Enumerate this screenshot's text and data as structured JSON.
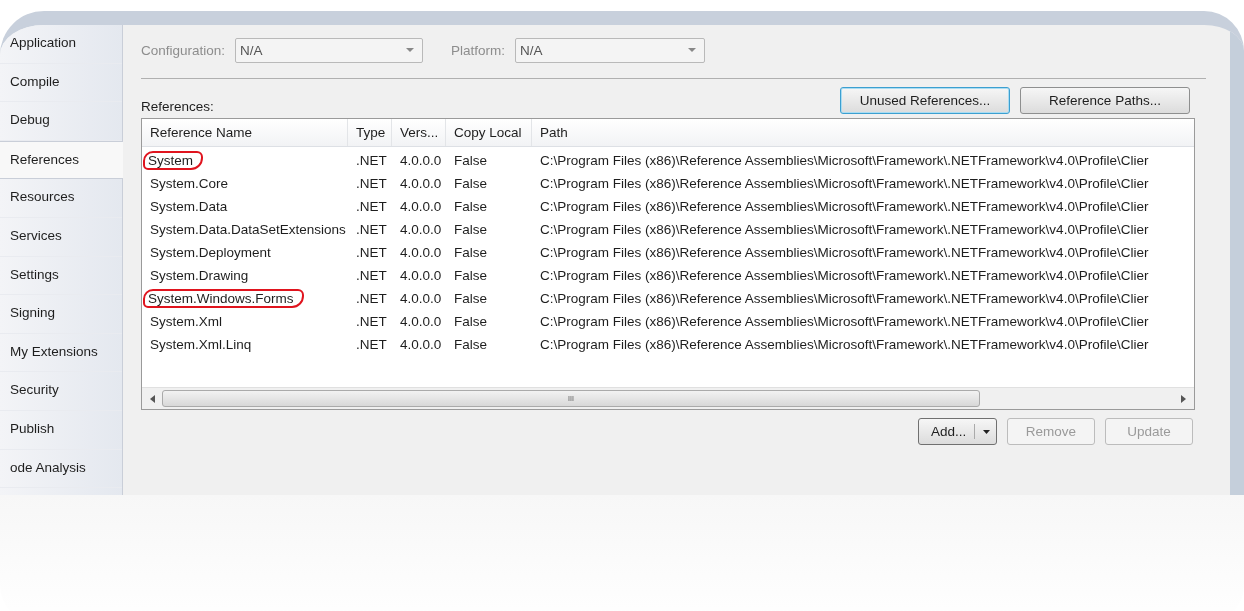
{
  "sidebar": {
    "items": [
      {
        "label": "Application",
        "selected": false
      },
      {
        "label": "Compile",
        "selected": false
      },
      {
        "label": "Debug",
        "selected": false
      },
      {
        "label": "References",
        "selected": true
      },
      {
        "label": "Resources",
        "selected": false
      },
      {
        "label": "Services",
        "selected": false
      },
      {
        "label": "Settings",
        "selected": false
      },
      {
        "label": "Signing",
        "selected": false
      },
      {
        "label": "My Extensions",
        "selected": false
      },
      {
        "label": "Security",
        "selected": false
      },
      {
        "label": "Publish",
        "selected": false
      },
      {
        "label": "ode Analysis",
        "selected": false
      }
    ]
  },
  "configuration": {
    "label": "Configuration:",
    "value": "N/A",
    "disabled": true
  },
  "platform": {
    "label": "Platform:",
    "value": "N/A",
    "disabled": true
  },
  "buttons_top": [
    {
      "label": "Unused References...",
      "focused": true
    },
    {
      "label": "Reference Paths...",
      "focused": false
    }
  ],
  "references_label": "References:",
  "table": {
    "columns": [
      "Reference Name",
      "Type",
      "Vers...",
      "Copy Local",
      "Path"
    ],
    "rows": [
      {
        "cells": [
          "System",
          ".NET",
          "4.0.0.0",
          "False",
          "C:\\Program Files (x86)\\Reference Assemblies\\Microsoft\\Framework\\.NETFramework\\v4.0\\Profile\\Clier"
        ],
        "circled": true
      },
      {
        "cells": [
          "System.Core",
          ".NET",
          "4.0.0.0",
          "False",
          "C:\\Program Files (x86)\\Reference Assemblies\\Microsoft\\Framework\\.NETFramework\\v4.0\\Profile\\Clier"
        ],
        "circled": false
      },
      {
        "cells": [
          "System.Data",
          ".NET",
          "4.0.0.0",
          "False",
          "C:\\Program Files (x86)\\Reference Assemblies\\Microsoft\\Framework\\.NETFramework\\v4.0\\Profile\\Clier"
        ],
        "circled": false
      },
      {
        "cells": [
          "System.Data.DataSetExtensions",
          ".NET",
          "4.0.0.0",
          "False",
          "C:\\Program Files (x86)\\Reference Assemblies\\Microsoft\\Framework\\.NETFramework\\v4.0\\Profile\\Clier"
        ],
        "circled": false
      },
      {
        "cells": [
          "System.Deployment",
          ".NET",
          "4.0.0.0",
          "False",
          "C:\\Program Files (x86)\\Reference Assemblies\\Microsoft\\Framework\\.NETFramework\\v4.0\\Profile\\Clier"
        ],
        "circled": false
      },
      {
        "cells": [
          "System.Drawing",
          ".NET",
          "4.0.0.0",
          "False",
          "C:\\Program Files (x86)\\Reference Assemblies\\Microsoft\\Framework\\.NETFramework\\v4.0\\Profile\\Clier"
        ],
        "circled": false
      },
      {
        "cells": [
          "System.Windows.Forms",
          ".NET",
          "4.0.0.0",
          "False",
          "C:\\Program Files (x86)\\Reference Assemblies\\Microsoft\\Framework\\.NETFramework\\v4.0\\Profile\\Clier"
        ],
        "circled": true
      },
      {
        "cells": [
          "System.Xml",
          ".NET",
          "4.0.0.0",
          "False",
          "C:\\Program Files (x86)\\Reference Assemblies\\Microsoft\\Framework\\.NETFramework\\v4.0\\Profile\\Clier"
        ],
        "circled": false
      },
      {
        "cells": [
          "System.Xml.Linq",
          ".NET",
          "4.0.0.0",
          "False",
          "C:\\Program Files (x86)\\Reference Assemblies\\Microsoft\\Framework\\.NETFramework\\v4.0\\Profile\\Clier"
        ],
        "circled": false
      }
    ]
  },
  "scroll_grip": "III",
  "buttons_bottom": [
    {
      "label": "Add...",
      "kind": "split",
      "disabled": false
    },
    {
      "label": "Remove",
      "kind": "plain",
      "disabled": true
    },
    {
      "label": "Update",
      "kind": "plain",
      "disabled": true
    }
  ]
}
